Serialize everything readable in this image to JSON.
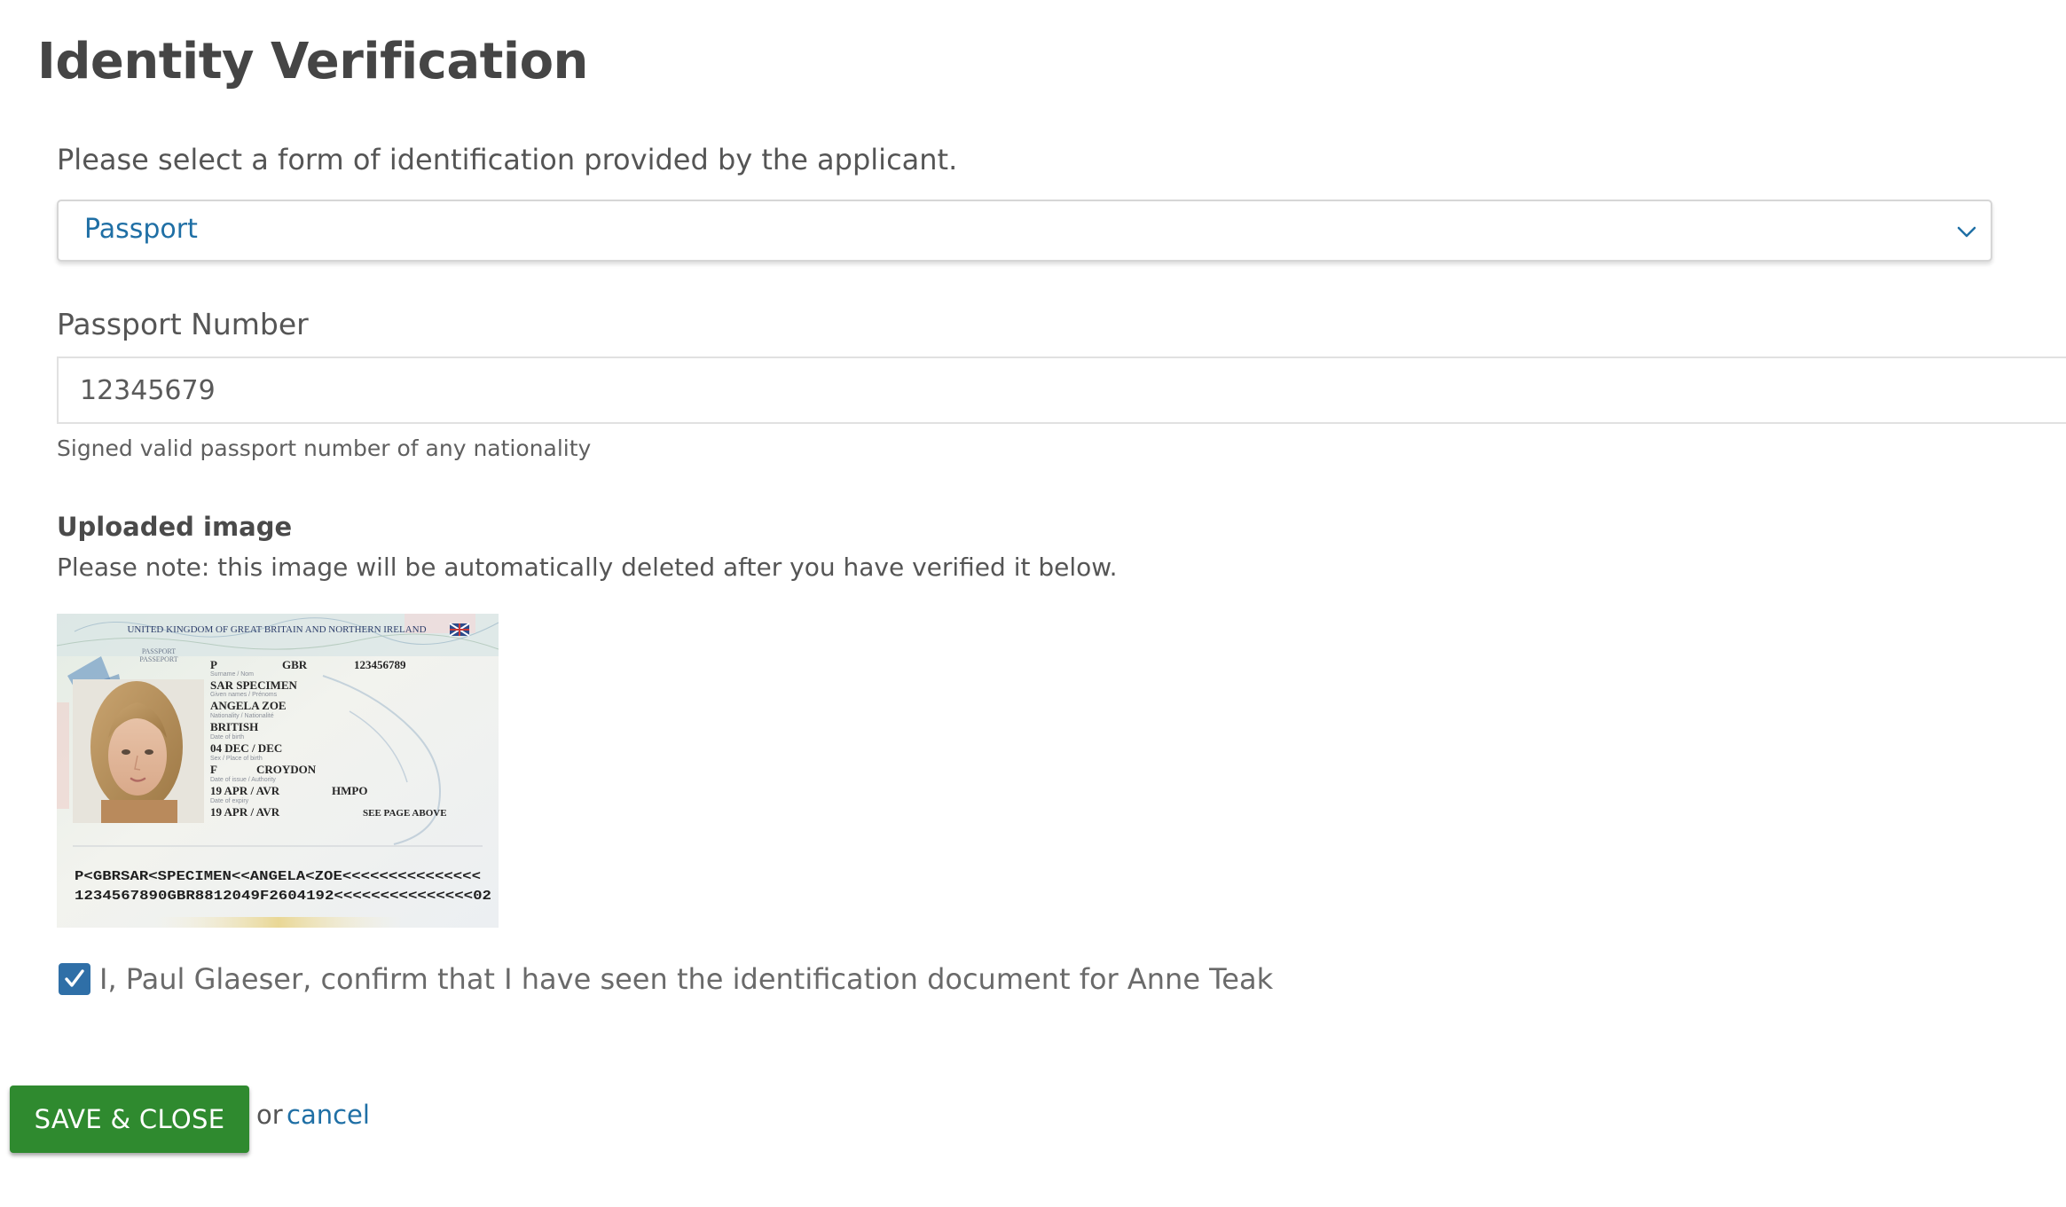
{
  "page": {
    "title": "Identity Verification"
  },
  "id_type": {
    "prompt": "Please select a form of identification provided by the applicant.",
    "selected": "Passport"
  },
  "passport_number": {
    "label": "Passport Number",
    "value": "12345679",
    "help": "Signed valid passport number of any nationality"
  },
  "upload": {
    "heading": "Uploaded image",
    "note": "Please note: this image will be automatically deleted after you have verified it below.",
    "passport": {
      "header": "UNITED KINGDOM OF GREAT BRITAIN AND NORTHERN IRELAND",
      "doc_label_1": "PASSPORT",
      "doc_label_2": "PASSEPORT",
      "type": "P",
      "country": "GBR",
      "number": "123456789",
      "surname": "SAR SPECIMEN",
      "given_names": "ANGELA ZOE",
      "nationality": "BRITISH",
      "date_of_birth": "04 DEC / DEC",
      "sex": "F",
      "place_of_birth": "CROYDON",
      "date_of_issue": "19 APR / AVR",
      "authority": "HMPO",
      "date_of_expiry": "19 APR / AVR",
      "signature": "SEE PAGE ABOVE",
      "mrz_line_1": "P<GBRSAR<SPECIMEN<<ANGELA<ZOE<<<<<<<<<<<<<<<",
      "mrz_line_2": "1234567890GBR8812049F2604192<<<<<<<<<<<<<<<02"
    }
  },
  "confirmation": {
    "checked": true,
    "text": "I, Paul Glaeser, confirm that I have seen the identification document for Anne Teak"
  },
  "actions": {
    "save_label": "SAVE & CLOSE",
    "or_text": "or",
    "cancel_label": "cancel"
  },
  "colors": {
    "link_blue": "#1f6fa5",
    "save_green": "#2f8a2f",
    "checkbox_blue": "#2f6fa7"
  }
}
